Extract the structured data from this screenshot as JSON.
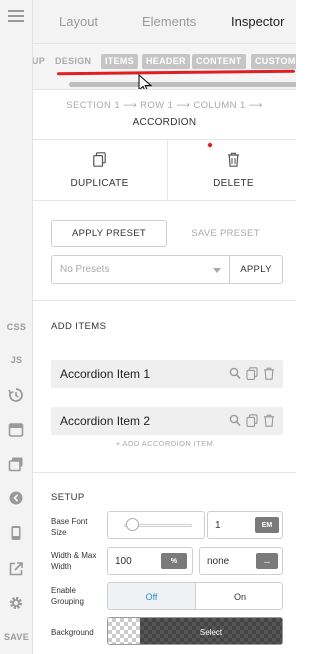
{
  "tabs": {
    "layout": "Layout",
    "elements": "Elements",
    "inspector": "Inspector"
  },
  "subtabs": {
    "prev_clip": "UP",
    "design": "DESIGN",
    "items": "ITEMS",
    "header": "HEADER",
    "content": "CONTENT",
    "custom": "CUSTOM"
  },
  "breadcrumb": {
    "path": "SECTION 1 ⟶ ROW 1 ⟶ COLUMN 1 ⟶",
    "current": "ACCORDION"
  },
  "actions": {
    "duplicate": "DUPLICATE",
    "delete": "DELETE"
  },
  "presets": {
    "apply_preset": "APPLY PRESET",
    "save_preset": "SAVE PRESET",
    "select_value": "No Presets",
    "apply": "APPLY"
  },
  "add_items": {
    "title": "ADD ITEMS",
    "items": [
      {
        "label": "Accordion Item 1"
      },
      {
        "label": "Accordion Item 2"
      }
    ],
    "add_link": "+ ADD ACCORDION ITEM"
  },
  "setup": {
    "title": "SETUP",
    "base_font_size": {
      "label": "Base Font Size",
      "value": "1",
      "unit": "EM",
      "slider_fraction": 0.06
    },
    "width_max_width": {
      "label": "Width & Max Width",
      "width_value": "100",
      "width_unit": "%",
      "max_value": "none",
      "max_unit": "..."
    },
    "enable_grouping": {
      "label": "Enable Grouping",
      "off": "Off",
      "on": "On",
      "selected": "Off"
    },
    "background": {
      "label": "Background",
      "select": "Select"
    }
  },
  "rail": {
    "css": "CSS",
    "js": "JS",
    "save": "SAVE"
  },
  "colors": {
    "accent_red": "#e02020",
    "chip_gray": "#c5c5c5",
    "dark_chip": "#7a7a7a",
    "toggle_active": "#2f8fd0"
  }
}
